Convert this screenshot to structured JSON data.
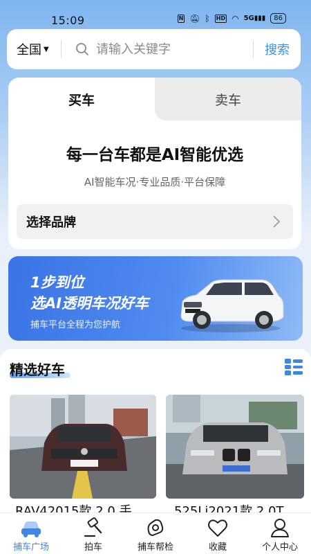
{
  "status": {
    "time": "15:09",
    "battery": "86",
    "signal": "5G"
  },
  "search": {
    "region": "全国",
    "placeholder": "请输入关键字",
    "button": "搜索"
  },
  "trade": {
    "tabs": [
      "买车",
      "卖车"
    ],
    "active_tab": "买车",
    "headline": "每一台车都是AI智能优选",
    "subline": "AI智能车况·专业品质·平台保障",
    "brand_select": "选择品牌"
  },
  "banner": {
    "line1": "1步到位",
    "line2": "选AI透明车况好车",
    "sub": "捕车平台全程为您护航"
  },
  "featured": {
    "title": "精选好车",
    "cars": [
      {
        "name": "RAV42015款 2.0 手"
      },
      {
        "name": "525Li2021款 2.0T"
      }
    ]
  },
  "tabbar": [
    {
      "label": "捕车广场",
      "icon": "car-icon",
      "active": true
    },
    {
      "label": "拍车",
      "icon": "gavel-icon",
      "active": false
    },
    {
      "label": "捕车帮检",
      "icon": "inspect-icon",
      "active": false
    },
    {
      "label": "收藏",
      "icon": "heart-icon",
      "active": false
    },
    {
      "label": "个人中心",
      "icon": "user-icon",
      "active": false
    }
  ],
  "colors": {
    "accent": "#3f86e6",
    "banner": "#4a84ec"
  }
}
